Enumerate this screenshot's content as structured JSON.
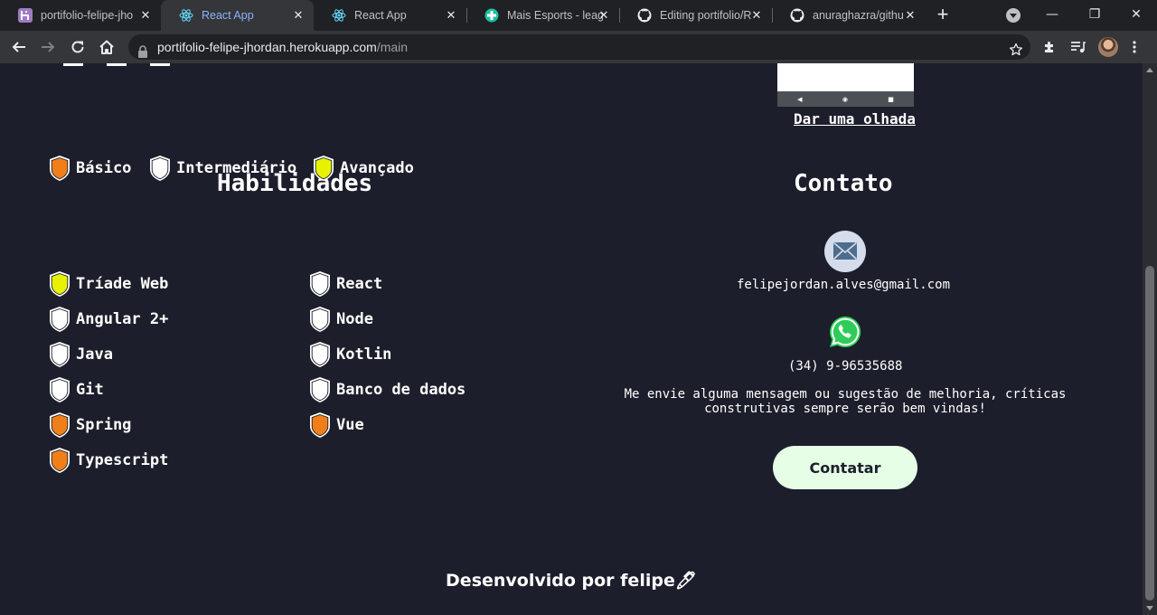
{
  "browser": {
    "tabs": [
      {
        "title": "portifolio-felipe-jho",
        "favicon": "heroku-icon",
        "active": false
      },
      {
        "title": "React App",
        "favicon": "react-icon",
        "active": true
      },
      {
        "title": "React App",
        "favicon": "react-icon",
        "active": false
      },
      {
        "title": "Mais Esports - leag",
        "favicon": "esports-icon",
        "active": false
      },
      {
        "title": "Editing portifolio/R",
        "favicon": "github-icon",
        "active": false
      },
      {
        "title": "anuraghazra/githu",
        "favicon": "github-icon",
        "active": false
      }
    ],
    "new_tab": "+",
    "close_glyph": "✕",
    "url_host": "portifolio-felipe-jhordan.herokuapp.com",
    "url_path": "/main",
    "window_controls": {
      "minimize": "—",
      "maximize": "❐",
      "close": "✕"
    },
    "icons": [
      "back-icon",
      "forward-icon",
      "reload-icon",
      "home-icon",
      "lock-icon",
      "star-icon",
      "extensions-icon",
      "media-control-icon",
      "profile-avatar",
      "menu-icon"
    ]
  },
  "project_preview": {
    "nav_glyphs": [
      "◀",
      "◉",
      "■"
    ],
    "link": "Dar uma olhada"
  },
  "skills": {
    "title": "Habilidades",
    "legend": [
      {
        "label": "Básico",
        "color": "#f07f1a"
      },
      {
        "label": "Intermediário",
        "color": "#ffffff"
      },
      {
        "label": "Avançado",
        "color": "#e8f200"
      }
    ],
    "items": [
      {
        "label": "Tríade Web",
        "level": "Avançado",
        "color": "#e8f200"
      },
      {
        "label": "React",
        "level": "Intermediário",
        "color": "#ffffff"
      },
      {
        "label": "Angular 2+",
        "level": "Intermediário",
        "color": "#ffffff"
      },
      {
        "label": "Node",
        "level": "Intermediário",
        "color": "#ffffff"
      },
      {
        "label": "Java",
        "level": "Intermediário",
        "color": "#ffffff"
      },
      {
        "label": "Kotlin",
        "level": "Intermediário",
        "color": "#ffffff"
      },
      {
        "label": "Git",
        "level": "Intermediário",
        "color": "#ffffff"
      },
      {
        "label": "Banco de dados",
        "level": "Intermediário",
        "color": "#ffffff"
      },
      {
        "label": "Spring",
        "level": "Básico",
        "color": "#f07f1a"
      },
      {
        "label": "Vue",
        "level": "Básico",
        "color": "#f07f1a"
      },
      {
        "label": "Typescript",
        "level": "Básico",
        "color": "#f07f1a"
      }
    ]
  },
  "contact": {
    "title": "Contato",
    "email": "felipejordan.alves@gmail.com",
    "phone": "(34) 9-96535688",
    "message": "Me envie alguma mensagem ou sugestão de melhoria, críticas construtivas sempre serão bem vindas!",
    "button_label": "Contatar",
    "icons": [
      "email-icon",
      "whatsapp-icon"
    ]
  },
  "footer": {
    "text": "Desenvolvido por felipe",
    "emoji": "🖊"
  },
  "colors": {
    "background": "#1c1f2b",
    "button_bg": "#e6fde6",
    "basic": "#f07f1a",
    "intermediate": "#ffffff",
    "advanced": "#e8f200"
  }
}
